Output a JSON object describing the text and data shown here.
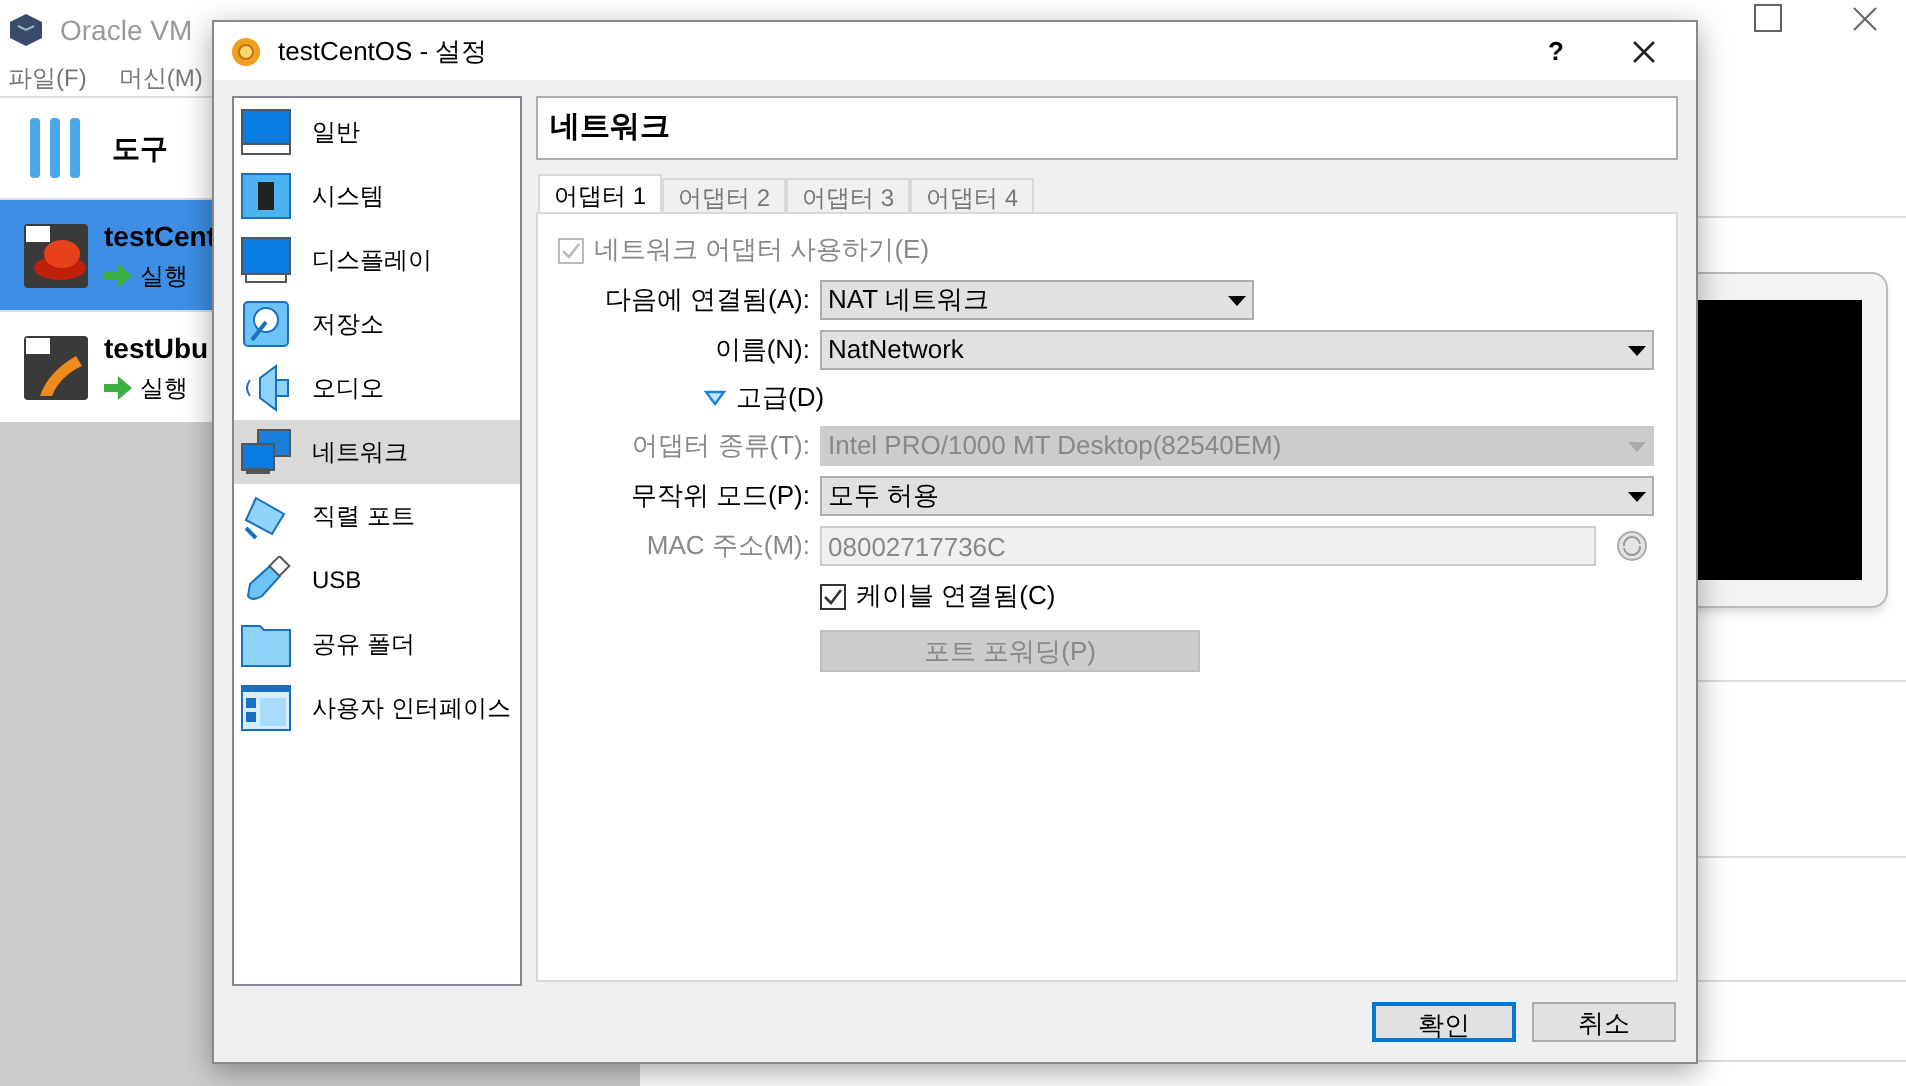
{
  "manager": {
    "title": "Oracle VM",
    "menu": [
      "파일(F)",
      "머신(M)"
    ],
    "tools_label": "도구",
    "vms": [
      {
        "name": "testCent",
        "status": "실행",
        "selected": true
      },
      {
        "name": "testUbu",
        "status": "실행",
        "selected": false
      }
    ]
  },
  "dialog": {
    "title": "testCentOS - 설정",
    "help": "?",
    "sidebar": [
      {
        "label": "일반",
        "selected": false
      },
      {
        "label": "시스템",
        "selected": false
      },
      {
        "label": "디스플레이",
        "selected": false
      },
      {
        "label": "저장소",
        "selected": false
      },
      {
        "label": "오디오",
        "selected": false
      },
      {
        "label": "네트워크",
        "selected": true
      },
      {
        "label": "직렬 포트",
        "selected": false
      },
      {
        "label": "USB",
        "selected": false
      },
      {
        "label": "공유 폴더",
        "selected": false
      },
      {
        "label": "사용자 인터페이스",
        "selected": false
      }
    ],
    "page_title": "네트워크",
    "tabs": [
      {
        "label": "어댑터 1",
        "selected": true
      },
      {
        "label": "어댑터 2",
        "selected": false
      },
      {
        "label": "어댑터 3",
        "selected": false
      },
      {
        "label": "어댑터 4",
        "selected": false
      }
    ],
    "rows": [
      {
        "kind": "checkbox_wide",
        "label": "네트워크 어댑터 사용하기(E)",
        "checked": true,
        "disabled": true
      },
      {
        "kind": "select_short",
        "label": "다음에 연결됨(A):",
        "value": "NAT 네트워크",
        "disabled": false
      },
      {
        "kind": "select",
        "label": "이름(N):",
        "value": "NatNetwork",
        "disabled": false
      },
      {
        "kind": "toggle",
        "label": "고급(D)",
        "expanded": true
      },
      {
        "kind": "select",
        "label": "어댑터 종류(T):",
        "value": "Intel PRO/1000 MT Desktop(82540EM)",
        "disabled": true
      },
      {
        "kind": "select",
        "label": "무작위 모드(P):",
        "value": "모두 허용",
        "disabled": false
      },
      {
        "kind": "text",
        "label": "MAC 주소(M):",
        "value": "08002717736C",
        "disabled": true
      },
      {
        "kind": "checkbox",
        "label": "케이블 연결됨(C)",
        "checked": true,
        "disabled": false
      },
      {
        "kind": "button",
        "label": "포트 포워딩(P)",
        "disabled": true
      }
    ],
    "buttons": [
      {
        "label": "확인",
        "default": true
      },
      {
        "label": "취소",
        "default": false
      }
    ]
  }
}
